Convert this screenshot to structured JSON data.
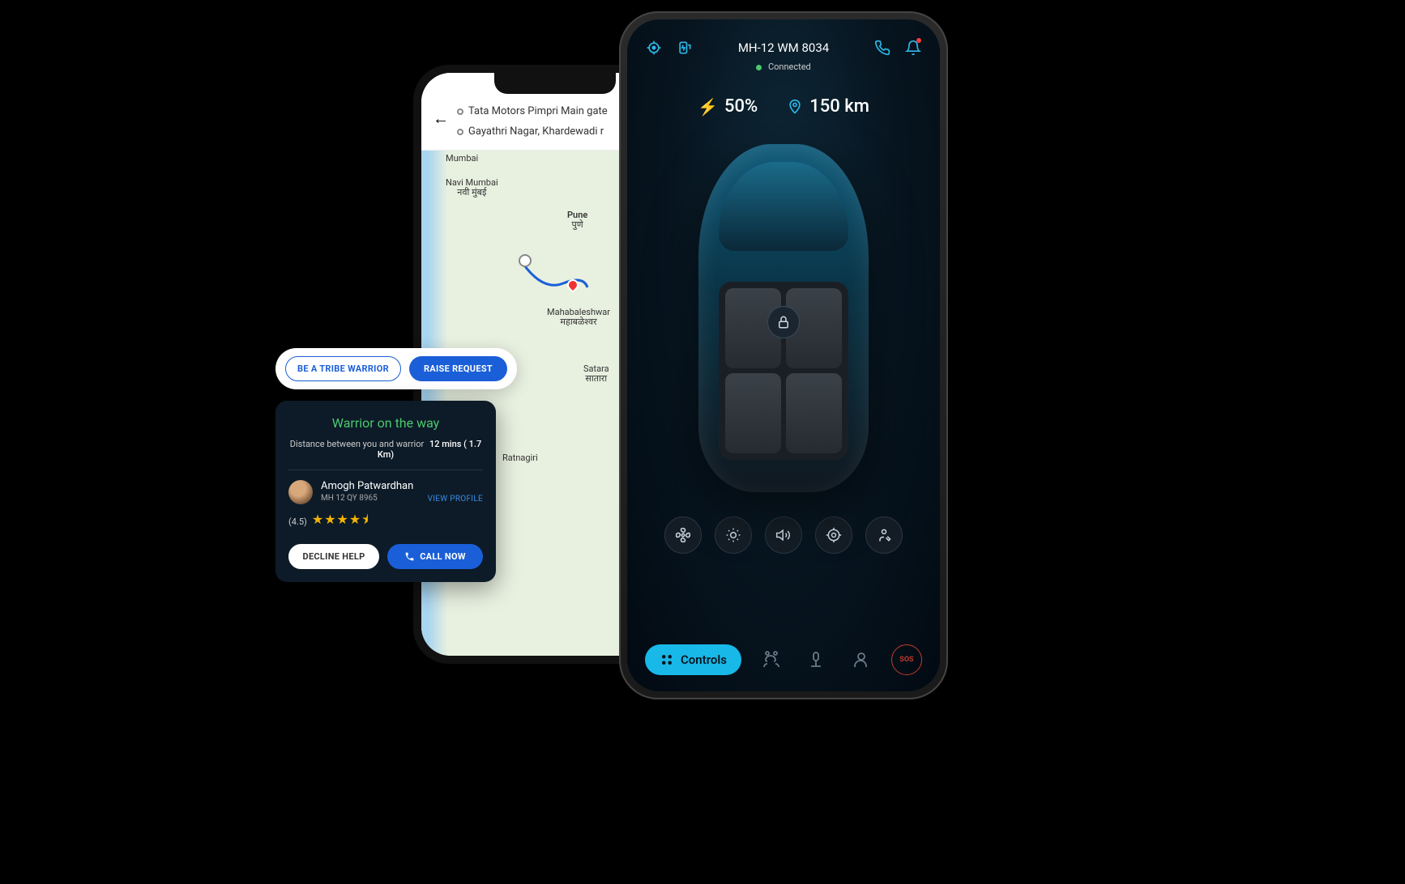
{
  "route": {
    "origin": "Tata Motors Pimpri Main gate",
    "destination": "Gayathri Nagar, Khardewadi r"
  },
  "map_cities": {
    "mumbai": "Mumbai",
    "navi": "Navi Mumbai",
    "navi_sub": "नवी मुंबई",
    "pune": "Pune",
    "pune_sub": "पुणे",
    "mahab": "Mahabaleshwar",
    "mahab_sub": "महाबळेश्वर",
    "satara": "Satara",
    "satara_sub": "सातारा",
    "ratna": "Ratnagiri"
  },
  "actions": {
    "warrior": "BE A TRIBE WARRIOR",
    "raise": "RAISE REQUEST"
  },
  "warrior": {
    "title": "Warrior on  the way",
    "distance_label": "Distance between you and warrior",
    "eta": "12 mins ( 1.7 Km)",
    "name": "Amogh Patwardhan",
    "plate": "MH 12 QY 8965",
    "view_profile": "VIEW PROFILE",
    "rating": "(4.5)",
    "stars": "★★★★⯨",
    "decline": "DECLINE  HELP",
    "call": "CALL NOW"
  },
  "vehicle": {
    "plate": "MH-12 WM 8034",
    "connection": "Connected",
    "battery": "50%",
    "range": "150 km"
  },
  "nav": {
    "controls": "Controls",
    "sos": "SOS"
  }
}
